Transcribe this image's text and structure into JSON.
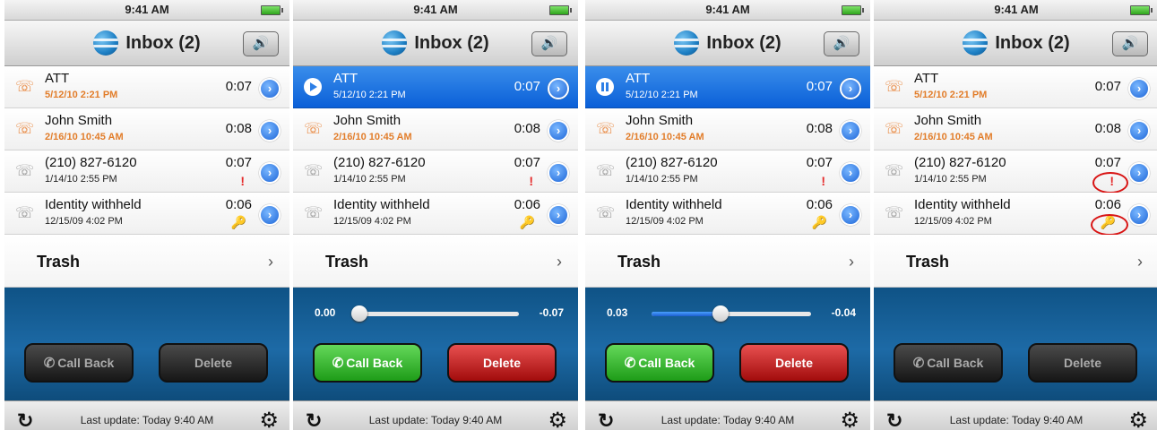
{
  "panels": [
    {
      "time": "9:41 AM",
      "title": "Inbox (2)",
      "trash": "Trash",
      "last_update": "Last update: Today 9:40 AM",
      "call_back": "Call Back",
      "delete": "Delete",
      "show_slider": false,
      "slider_left": "",
      "slider_right": "",
      "slider_progress": 0,
      "buttons_enabled": false,
      "highlighted_marks": false,
      "rows": [
        {
          "name": "ATT",
          "date": "5/12/10 2:21 PM",
          "duration": "0:07",
          "new": true,
          "selected": false,
          "state": "none",
          "mark": ""
        },
        {
          "name": "John Smith",
          "date": "2/16/10 10:45 AM",
          "duration": "0:08",
          "new": true,
          "selected": false,
          "state": "none",
          "mark": ""
        },
        {
          "name": "(210) 827-6120",
          "date": "1/14/10 2:55 PM",
          "duration": "0:07",
          "new": false,
          "selected": false,
          "state": "none",
          "mark": "!"
        },
        {
          "name": "Identity withheld",
          "date": "12/15/09 4:02 PM",
          "duration": "0:06",
          "new": false,
          "selected": false,
          "state": "none",
          "mark": "key"
        }
      ]
    },
    {
      "time": "9:41 AM",
      "title": "Inbox (2)",
      "trash": "Trash",
      "last_update": "Last update: Today 9:40 AM",
      "call_back": "Call Back",
      "delete": "Delete",
      "show_slider": true,
      "slider_left": "0.00",
      "slider_right": "-0.07",
      "slider_progress": 0.0,
      "buttons_enabled": true,
      "highlighted_marks": false,
      "rows": [
        {
          "name": "ATT",
          "date": "5/12/10 2:21 PM",
          "duration": "0:07",
          "new": false,
          "selected": true,
          "state": "play",
          "mark": ""
        },
        {
          "name": "John Smith",
          "date": "2/16/10 10:45 AM",
          "duration": "0:08",
          "new": true,
          "selected": false,
          "state": "none",
          "mark": ""
        },
        {
          "name": "(210) 827-6120",
          "date": "1/14/10 2:55 PM",
          "duration": "0:07",
          "new": false,
          "selected": false,
          "state": "none",
          "mark": "!"
        },
        {
          "name": "Identity withheld",
          "date": "12/15/09 4:02 PM",
          "duration": "0:06",
          "new": false,
          "selected": false,
          "state": "none",
          "mark": "key"
        }
      ]
    },
    {
      "time": "9:41 AM",
      "title": "Inbox (2)",
      "trash": "Trash",
      "last_update": "Last update: Today 9:40 AM",
      "call_back": "Call Back",
      "delete": "Delete",
      "show_slider": true,
      "slider_left": "0.03",
      "slider_right": "-0.04",
      "slider_progress": 0.43,
      "buttons_enabled": true,
      "highlighted_marks": false,
      "rows": [
        {
          "name": "ATT",
          "date": "5/12/10 2:21 PM",
          "duration": "0:07",
          "new": false,
          "selected": true,
          "state": "pause",
          "mark": ""
        },
        {
          "name": "John Smith",
          "date": "2/16/10 10:45 AM",
          "duration": "0:08",
          "new": true,
          "selected": false,
          "state": "none",
          "mark": ""
        },
        {
          "name": "(210) 827-6120",
          "date": "1/14/10 2:55 PM",
          "duration": "0:07",
          "new": false,
          "selected": false,
          "state": "none",
          "mark": "!"
        },
        {
          "name": "Identity withheld",
          "date": "12/15/09 4:02 PM",
          "duration": "0:06",
          "new": false,
          "selected": false,
          "state": "none",
          "mark": "key"
        }
      ]
    },
    {
      "time": "9:41 AM",
      "title": "Inbox (2)",
      "trash": "Trash",
      "last_update": "Last update: Today 9:40 AM",
      "call_back": "Call Back",
      "delete": "Delete",
      "show_slider": false,
      "slider_left": "",
      "slider_right": "",
      "slider_progress": 0,
      "buttons_enabled": false,
      "highlighted_marks": true,
      "rows": [
        {
          "name": "ATT",
          "date": "5/12/10 2:21 PM",
          "duration": "0:07",
          "new": true,
          "selected": false,
          "state": "none",
          "mark": ""
        },
        {
          "name": "John Smith",
          "date": "2/16/10 10:45 AM",
          "duration": "0:08",
          "new": true,
          "selected": false,
          "state": "none",
          "mark": ""
        },
        {
          "name": "(210) 827-6120",
          "date": "1/14/10 2:55 PM",
          "duration": "0:07",
          "new": false,
          "selected": false,
          "state": "none",
          "mark": "!"
        },
        {
          "name": "Identity withheld",
          "date": "12/15/09 4:02 PM",
          "duration": "0:06",
          "new": false,
          "selected": false,
          "state": "none",
          "mark": "key"
        }
      ]
    }
  ],
  "icons": {
    "speaker": "speaker-icon",
    "globe": "att-globe-icon",
    "phone": "phone-handset-icon",
    "refresh": "refresh-icon",
    "settings": "gear-icon",
    "disclosure": "chevron-right-icon",
    "key": "key-icon",
    "urgent": "exclamation-icon"
  },
  "colors": {
    "selection_blue": "#0a5fd8",
    "new_orange": "#e27d2a",
    "call_green": "#1e9c18",
    "delete_red": "#a20c0c",
    "player_blue": "#1d6aa6"
  }
}
